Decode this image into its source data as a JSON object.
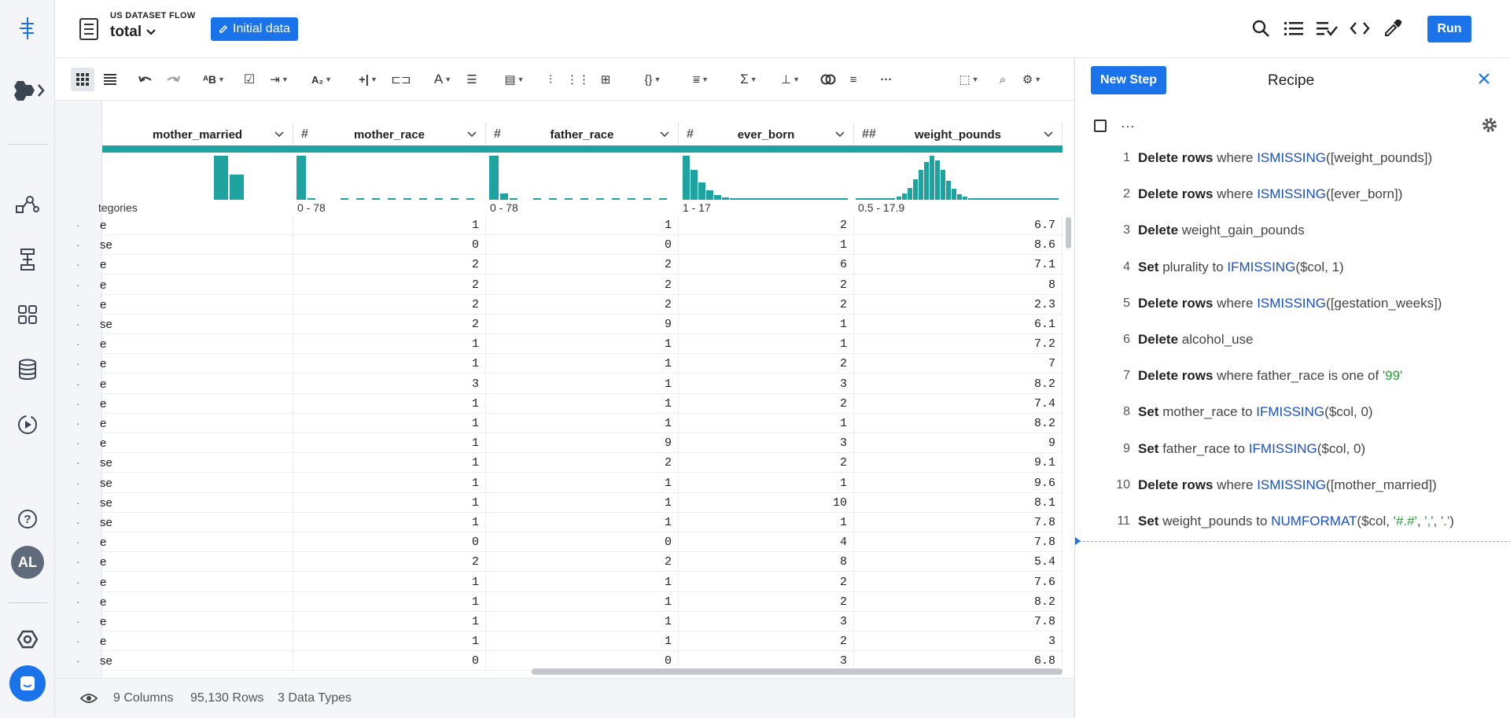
{
  "header": {
    "flow_label": "US DATASET FLOW",
    "dataset_name": "total",
    "initial_data_label": "Initial data",
    "run_label": "Run"
  },
  "columns": [
    {
      "name": "mother_married",
      "type_icon": "",
      "range": "tegories"
    },
    {
      "name": "mother_race",
      "type_icon": "#",
      "range": "0 - 78"
    },
    {
      "name": "father_race",
      "type_icon": "#",
      "range": "0 - 78"
    },
    {
      "name": "ever_born",
      "type_icon": "#",
      "range": "1 - 17"
    },
    {
      "name": "weight_pounds",
      "type_icon": "##",
      "range": "0.5 - 17.9"
    }
  ],
  "rows": [
    {
      "married": "e",
      "mother_race": "1",
      "father_race": "1",
      "ever_born": "2",
      "weight": "6.7"
    },
    {
      "married": "se",
      "mother_race": "0",
      "father_race": "0",
      "ever_born": "1",
      "weight": "8.6"
    },
    {
      "married": "e",
      "mother_race": "2",
      "father_race": "2",
      "ever_born": "6",
      "weight": "7.1"
    },
    {
      "married": "e",
      "mother_race": "2",
      "father_race": "2",
      "ever_born": "2",
      "weight": "8"
    },
    {
      "married": "e",
      "mother_race": "2",
      "father_race": "2",
      "ever_born": "2",
      "weight": "2.3"
    },
    {
      "married": "se",
      "mother_race": "2",
      "father_race": "9",
      "ever_born": "1",
      "weight": "6.1"
    },
    {
      "married": "e",
      "mother_race": "1",
      "father_race": "1",
      "ever_born": "1",
      "weight": "7.2"
    },
    {
      "married": "e",
      "mother_race": "1",
      "father_race": "1",
      "ever_born": "2",
      "weight": "7"
    },
    {
      "married": "e",
      "mother_race": "3",
      "father_race": "1",
      "ever_born": "3",
      "weight": "8.2"
    },
    {
      "married": "e",
      "mother_race": "1",
      "father_race": "1",
      "ever_born": "2",
      "weight": "7.4"
    },
    {
      "married": "e",
      "mother_race": "1",
      "father_race": "1",
      "ever_born": "1",
      "weight": "8.2"
    },
    {
      "married": "e",
      "mother_race": "1",
      "father_race": "9",
      "ever_born": "3",
      "weight": "9"
    },
    {
      "married": "se",
      "mother_race": "1",
      "father_race": "2",
      "ever_born": "2",
      "weight": "9.1"
    },
    {
      "married": "se",
      "mother_race": "1",
      "father_race": "1",
      "ever_born": "1",
      "weight": "9.6"
    },
    {
      "married": "se",
      "mother_race": "1",
      "father_race": "1",
      "ever_born": "10",
      "weight": "8.1"
    },
    {
      "married": "se",
      "mother_race": "1",
      "father_race": "1",
      "ever_born": "1",
      "weight": "7.8"
    },
    {
      "married": "e",
      "mother_race": "0",
      "father_race": "0",
      "ever_born": "4",
      "weight": "7.8"
    },
    {
      "married": "e",
      "mother_race": "2",
      "father_race": "2",
      "ever_born": "8",
      "weight": "5.4"
    },
    {
      "married": "e",
      "mother_race": "1",
      "father_race": "1",
      "ever_born": "2",
      "weight": "7.6"
    },
    {
      "married": "e",
      "mother_race": "1",
      "father_race": "1",
      "ever_born": "2",
      "weight": "8.2"
    },
    {
      "married": "e",
      "mother_race": "1",
      "father_race": "1",
      "ever_born": "3",
      "weight": "7.8"
    },
    {
      "married": "e",
      "mother_race": "1",
      "father_race": "1",
      "ever_born": "2",
      "weight": "3"
    },
    {
      "married": "se",
      "mother_race": "0",
      "father_race": "0",
      "ever_born": "3",
      "weight": "6.8"
    }
  ],
  "footer": {
    "columns": "9 Columns",
    "rows": "95,130 Rows",
    "types": "3 Data Types"
  },
  "recipe": {
    "new_step_label": "New Step",
    "title": "Recipe",
    "steps": [
      {
        "num": "1",
        "parts": [
          [
            "kw",
            "Delete rows"
          ],
          [
            "t",
            " where "
          ],
          [
            "fn",
            "ISMISSING"
          ],
          [
            "t",
            "([weight_pounds])"
          ]
        ]
      },
      {
        "num": "2",
        "parts": [
          [
            "kw",
            "Delete rows"
          ],
          [
            "t",
            " where "
          ],
          [
            "fn",
            "ISMISSING"
          ],
          [
            "t",
            "([ever_born])"
          ]
        ]
      },
      {
        "num": "3",
        "parts": [
          [
            "kw",
            "Delete"
          ],
          [
            "t",
            " weight_gain_pounds"
          ]
        ]
      },
      {
        "num": "4",
        "parts": [
          [
            "kw",
            "Set"
          ],
          [
            "t",
            " plurality to "
          ],
          [
            "fn",
            "IFMISSING"
          ],
          [
            "t",
            "($col, 1)"
          ]
        ]
      },
      {
        "num": "5",
        "parts": [
          [
            "kw",
            "Delete rows"
          ],
          [
            "t",
            " where "
          ],
          [
            "fn",
            "ISMISSING"
          ],
          [
            "t",
            "([gestation_weeks])"
          ]
        ]
      },
      {
        "num": "6",
        "parts": [
          [
            "kw",
            "Delete"
          ],
          [
            "t",
            " alcohol_use"
          ]
        ]
      },
      {
        "num": "7",
        "parts": [
          [
            "kw",
            "Delete rows"
          ],
          [
            "t",
            " where father_race is one of "
          ],
          [
            "lit",
            "'99'"
          ]
        ]
      },
      {
        "num": "8",
        "parts": [
          [
            "kw",
            "Set"
          ],
          [
            "t",
            " mother_race to "
          ],
          [
            "fn",
            "IFMISSING"
          ],
          [
            "t",
            "($col, 0)"
          ]
        ]
      },
      {
        "num": "9",
        "parts": [
          [
            "kw",
            "Set"
          ],
          [
            "t",
            " father_race to "
          ],
          [
            "fn",
            "IFMISSING"
          ],
          [
            "t",
            "($col, 0)"
          ]
        ]
      },
      {
        "num": "10",
        "parts": [
          [
            "kw",
            "Delete rows"
          ],
          [
            "t",
            " where "
          ],
          [
            "fn",
            "ISMISSING"
          ],
          [
            "t",
            "([mother_married])"
          ]
        ]
      },
      {
        "num": "11",
        "parts": [
          [
            "kw",
            "Set"
          ],
          [
            "t",
            " weight_pounds to "
          ],
          [
            "fn",
            "NUMFORMAT"
          ],
          [
            "t",
            "($col, "
          ],
          [
            "lit",
            "'#.#'"
          ],
          [
            "t",
            ", "
          ],
          [
            "lit",
            "','"
          ],
          [
            "t",
            ", "
          ],
          [
            "lit",
            "'.'"
          ],
          [
            "t",
            ")"
          ]
        ]
      }
    ]
  },
  "colors": {
    "accent": "#1a73e8",
    "teal": "#1fa3a1",
    "function": "#1b4fbf",
    "literal": "#2e9a3c"
  }
}
